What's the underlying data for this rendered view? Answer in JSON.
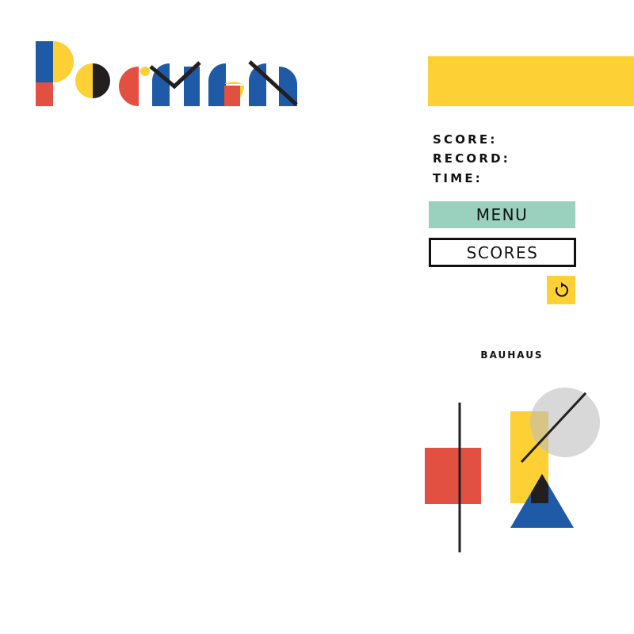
{
  "header": {
    "logo_text": "Pacman"
  },
  "stats": {
    "score_label": "SCORE:",
    "record_label": "RECORD:",
    "time_label": "TIME:"
  },
  "buttons": {
    "menu_label": "MENU",
    "scores_label": "SCORES",
    "restart_icon": "restart-icon"
  },
  "decoration": {
    "label": "BAUHAUS"
  },
  "colors": {
    "yellow": "#FDD036",
    "red": "#E25041",
    "blue": "#1F5AA6",
    "mint": "#9AD1BE",
    "black": "#231F20",
    "grey": "#D9D9D9"
  }
}
